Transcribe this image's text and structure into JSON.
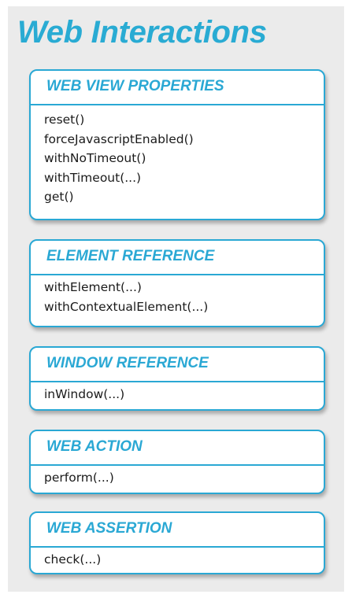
{
  "title": "Web Interactions",
  "colors": {
    "accent": "#2aa8d4",
    "background": "#ebebeb",
    "card": "#ffffff",
    "text": "#1a1a1a"
  },
  "sections": [
    {
      "heading": "WEB VIEW PROPERTIES",
      "methods": [
        "reset()",
        "forceJavascriptEnabled()",
        "withNoTimeout()",
        "withTimeout(...)",
        "get()"
      ]
    },
    {
      "heading": "ELEMENT REFERENCE",
      "methods": [
        "withElement(...)",
        "withContextualElement(...)"
      ]
    },
    {
      "heading": "WINDOW REFERENCE",
      "methods": [
        "inWindow(...)"
      ]
    },
    {
      "heading": "WEB ACTION",
      "methods": [
        "perform(...)"
      ]
    },
    {
      "heading": "WEB ASSERTION",
      "methods": [
        "check(...)"
      ]
    }
  ]
}
